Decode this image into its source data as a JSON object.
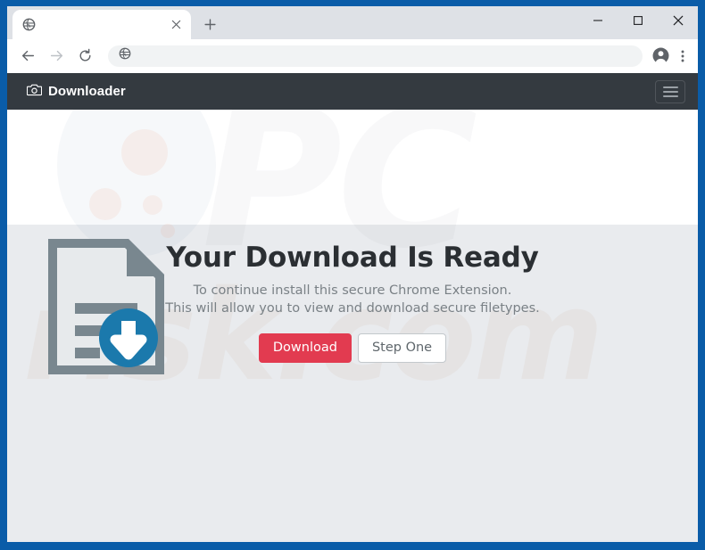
{
  "browser": {
    "tab": {
      "title": "",
      "favicon": "globe-icon",
      "close_icon": "close-icon"
    },
    "new_tab_label": "+",
    "window_controls": {
      "minimize": "minimize-icon",
      "maximize": "maximize-icon",
      "close": "close-icon"
    },
    "toolbar": {
      "back": "back-arrow-icon",
      "forward": "forward-arrow-icon",
      "reload": "reload-icon",
      "omnibox_value": "",
      "omnibox_placeholder": "",
      "omnibox_icon": "globe-icon",
      "profile": "profile-avatar-icon",
      "menu": "kebab-menu-icon"
    }
  },
  "site": {
    "navbar": {
      "brand": "Downloader",
      "brand_icon": "camera-icon",
      "menu_toggle": "hamburger-menu-icon"
    },
    "hero": {
      "document_icon": "document-download-icon",
      "headline": "Your Download Is Ready",
      "subtitle_line1": "To continue install this secure Chrome Extension.",
      "subtitle_line2": "This will allow you to view and download secure filetypes.",
      "primary_button": "Download",
      "secondary_button": "Step One"
    },
    "watermark": {
      "top": "PC",
      "bottom": "risk.com"
    }
  },
  "colors": {
    "window_frame": "#0a5ca8",
    "navbar_bg": "#343a40",
    "page_bg": "#e9ebee",
    "primary_button": "#e23b50",
    "download_badge": "#1b79ac",
    "document_gray": "#79878f"
  }
}
